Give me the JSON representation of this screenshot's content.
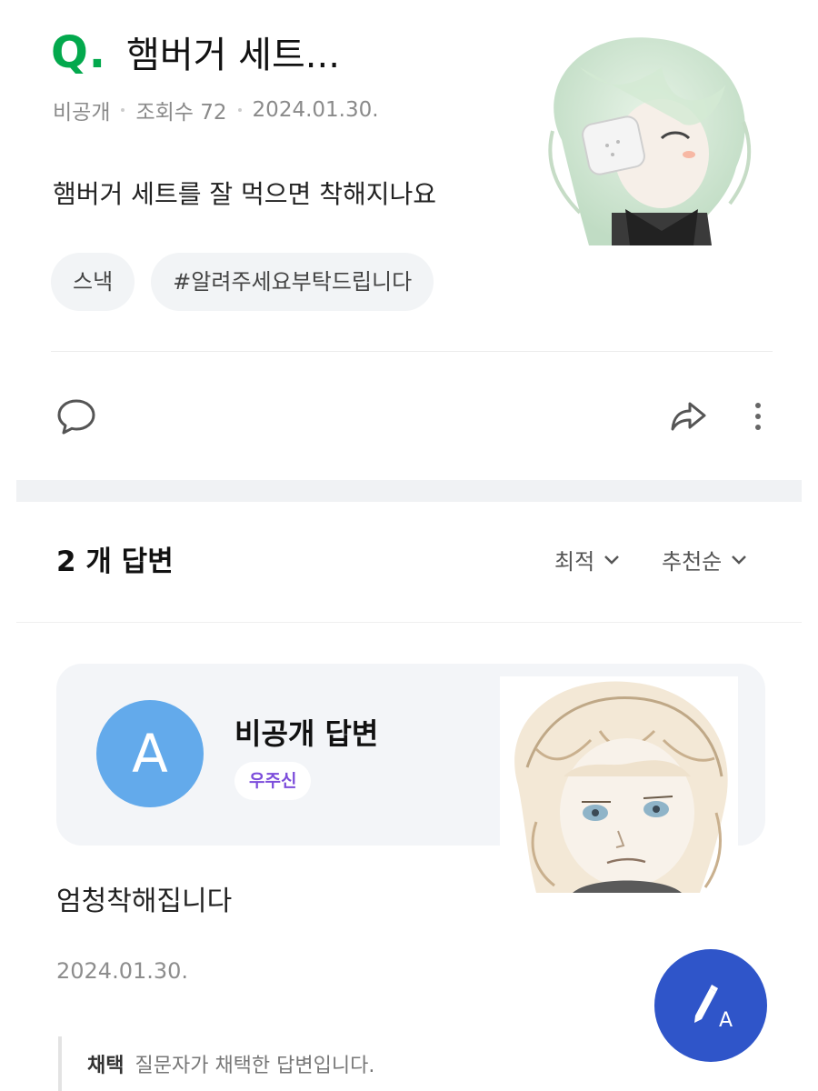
{
  "question": {
    "mark": "Q.",
    "title": "햄버거 세트...",
    "author": "비공개",
    "views": "조회수 72",
    "date": "2024.01.30.",
    "body": "햄버거 세트를 잘 먹으면 착해지나요",
    "tags": [
      "스낵",
      "#알려주세요부탁드립니다"
    ]
  },
  "actions": {
    "comment_icon": "comment-icon",
    "share_icon": "share-icon",
    "more_icon": "more-vertical-icon"
  },
  "answers": {
    "count_label": "2 개 답변",
    "sort_options": [
      "최적",
      "추천순"
    ]
  },
  "answer": {
    "avatar_letter": "A",
    "name": "비공개 답변",
    "grade": "우주신",
    "body": "엄청착해집니다",
    "date": "2024.01.30.",
    "adopt_label": "채택",
    "adopt_text": "질문자가 채택한 답변입니다."
  },
  "colors": {
    "q_mark": "#03a94d",
    "avatar": "#63aaeb",
    "grade_text": "#7c4ddb",
    "fab": "#2f55c9"
  },
  "fab_icon": "write-answer-icon"
}
